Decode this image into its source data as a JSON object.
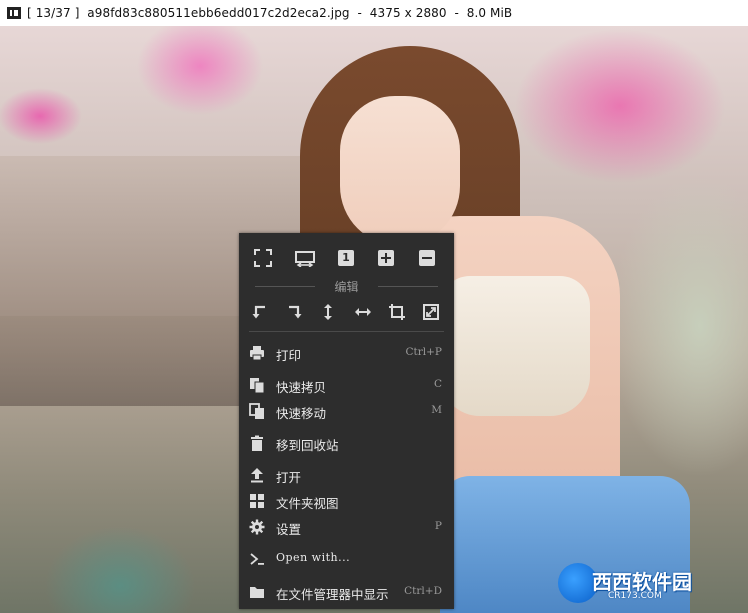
{
  "window": {
    "title": "[ 13/37 ]  a98fd83c880511ebb6edd017c2d2eca2.jpg  -  4375 x 2880  -  8.0 MiB"
  },
  "context_menu": {
    "top_icons": [
      "fullscreen-icon",
      "fit-width-icon",
      "original-size-icon",
      "zoom-in-icon",
      "zoom-out-icon"
    ],
    "original_size_label": "1",
    "edit_section_label": "编辑",
    "edit_icons": [
      "rotate-left-icon",
      "rotate-right-icon",
      "flip-vertical-icon",
      "flip-horizontal-icon",
      "crop-icon",
      "resize-icon"
    ],
    "items": [
      {
        "label": "打印",
        "shortcut": "Ctrl+P",
        "icon": "printer-icon"
      },
      {
        "label": "快速拷贝",
        "shortcut": "C",
        "icon": "copy-icon"
      },
      {
        "label": "快速移动",
        "shortcut": "M",
        "icon": "move-icon"
      },
      {
        "label": "移到回收站",
        "shortcut": "",
        "icon": "trash-icon"
      },
      {
        "label": "打开",
        "shortcut": "",
        "icon": "upload-icon"
      },
      {
        "label": "文件夹视图",
        "shortcut": "",
        "icon": "grid-icon"
      },
      {
        "label": "设置",
        "shortcut": "P",
        "icon": "gear-icon"
      },
      {
        "label": "Open with...",
        "shortcut": "",
        "icon": "terminal-icon"
      },
      {
        "label": "在文件管理器中显示",
        "shortcut": "Ctrl+D",
        "icon": "folder-icon"
      }
    ]
  },
  "watermark": {
    "brand": "西西软件园",
    "domain": "CR173.COM"
  },
  "colors": {
    "menu_bg": "#2d2d2d",
    "menu_text": "#eaeaea",
    "shortcut_text": "#9a9a9a",
    "titlebar_bg": "#ffffff"
  }
}
